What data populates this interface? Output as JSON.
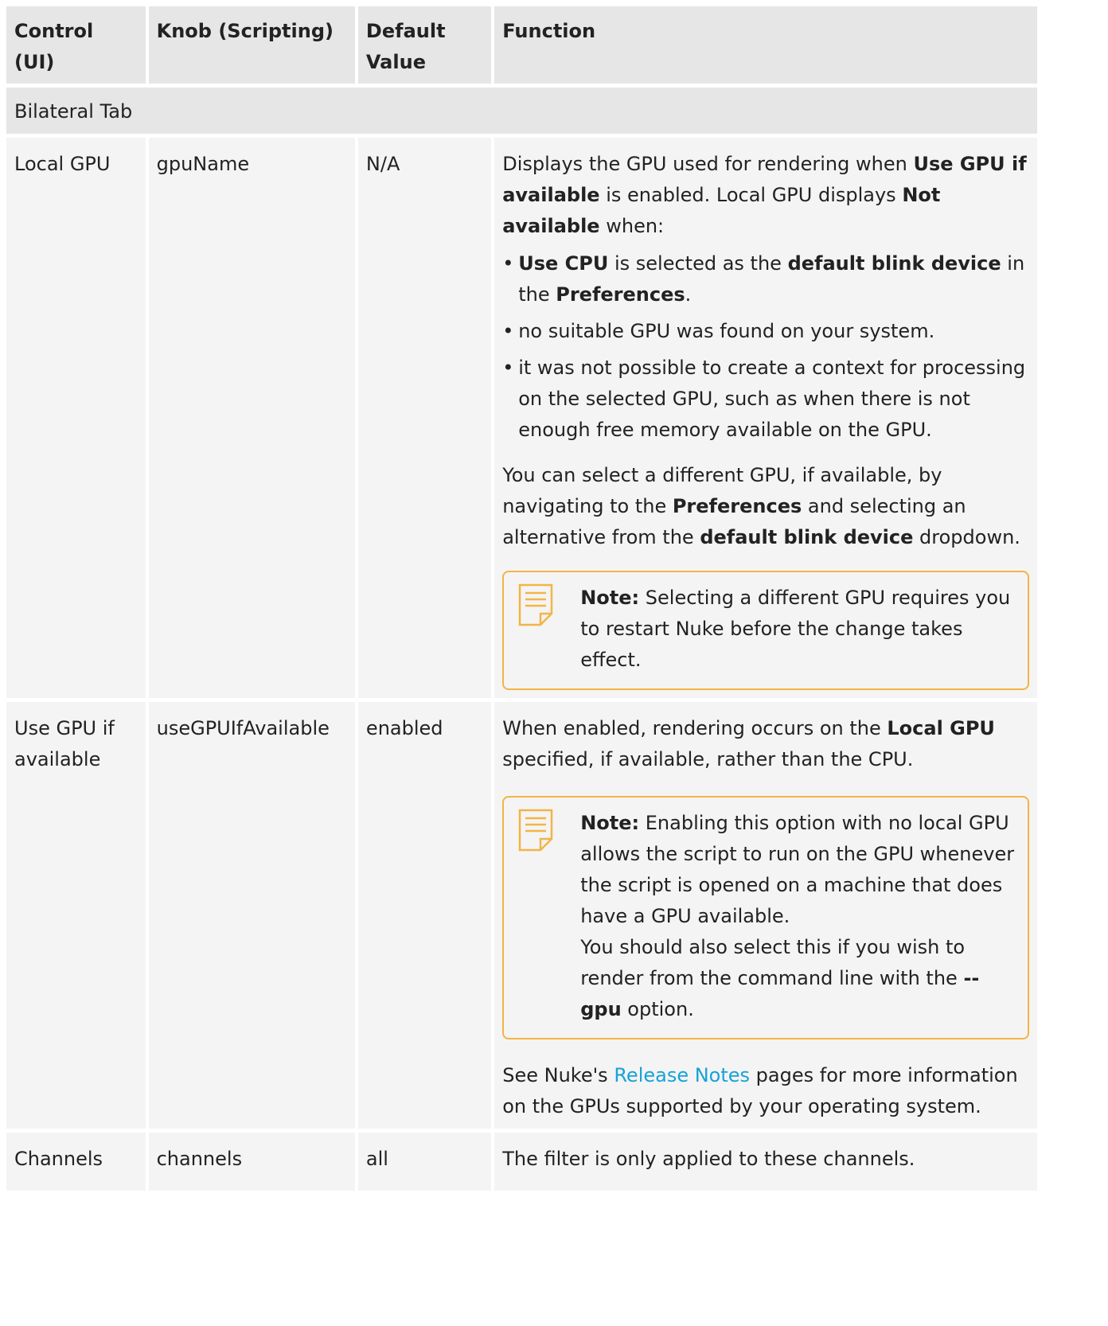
{
  "headers": [
    "Control (UI)",
    "Knob (Scripting)",
    "Default\nValue",
    "Function"
  ],
  "section_label": "Bilateral Tab",
  "rows": [
    {
      "control": "Local GPU",
      "knob": "gpuName",
      "default": "N/A",
      "function": {
        "p1_a": "Displays the GPU used for rendering when ",
        "p1_b1": "Use GPU if available",
        "p1_c": " is enabled. Local GPU displays ",
        "p1_b2": "Not available",
        "p1_d": " when:",
        "bullets": [
          {
            "b1": "Use CPU",
            "t1": " is selected as the ",
            "b2": "default blink device",
            "t2": " in the ",
            "b3": "Preferences",
            "t3": "."
          },
          {
            "text": "no suitable GPU was found on your system."
          },
          {
            "text": "it was not possible to create a context for processing on the selected GPU, such as when there is not enough free memory available on the GPU."
          }
        ],
        "p2_a": "You can select a different GPU, if available, by navigating to the ",
        "p2_b1": "Preferences",
        "p2_c": " and selecting an alternative from the ",
        "p2_b2": "default blink device",
        "p2_d": " dropdown.",
        "note_label": "Note:",
        "note_text": " Selecting a different GPU requires you to restart Nuke before the change takes effect."
      }
    },
    {
      "control": "Use GPU if available",
      "knob": "useGPUIfAvailable",
      "default": "enabled",
      "function": {
        "p1_a": "When enabled, rendering occurs on the ",
        "p1_b": "Local GPU",
        "p1_c": " specified, if available, rather than the CPU.",
        "note_label": "Note:",
        "note_text1": " Enabling this option with no local GPU allows the script to run on the GPU whenever the script is opened on a machine that does have a GPU available.",
        "note_text2_a": "You should also select this if you wish to render from the command line with the ",
        "note_text2_b": "--gpu",
        "note_text2_c": " option.",
        "p2_a": "See Nuke's ",
        "p2_link": "Release Notes",
        "p2_c": " pages for more information on the GPUs supported by your operating system."
      }
    },
    {
      "control": "Channels",
      "knob": "channels",
      "default": "all",
      "function": {
        "text": "The filter is only applied to these channels."
      }
    }
  ],
  "colors": {
    "header_bg": "#e6e6e6",
    "row_bg": "#f4f4f4",
    "note_border": "#f3b446",
    "link": "#17a2d8"
  },
  "icons": {
    "note": "note-icon"
  }
}
